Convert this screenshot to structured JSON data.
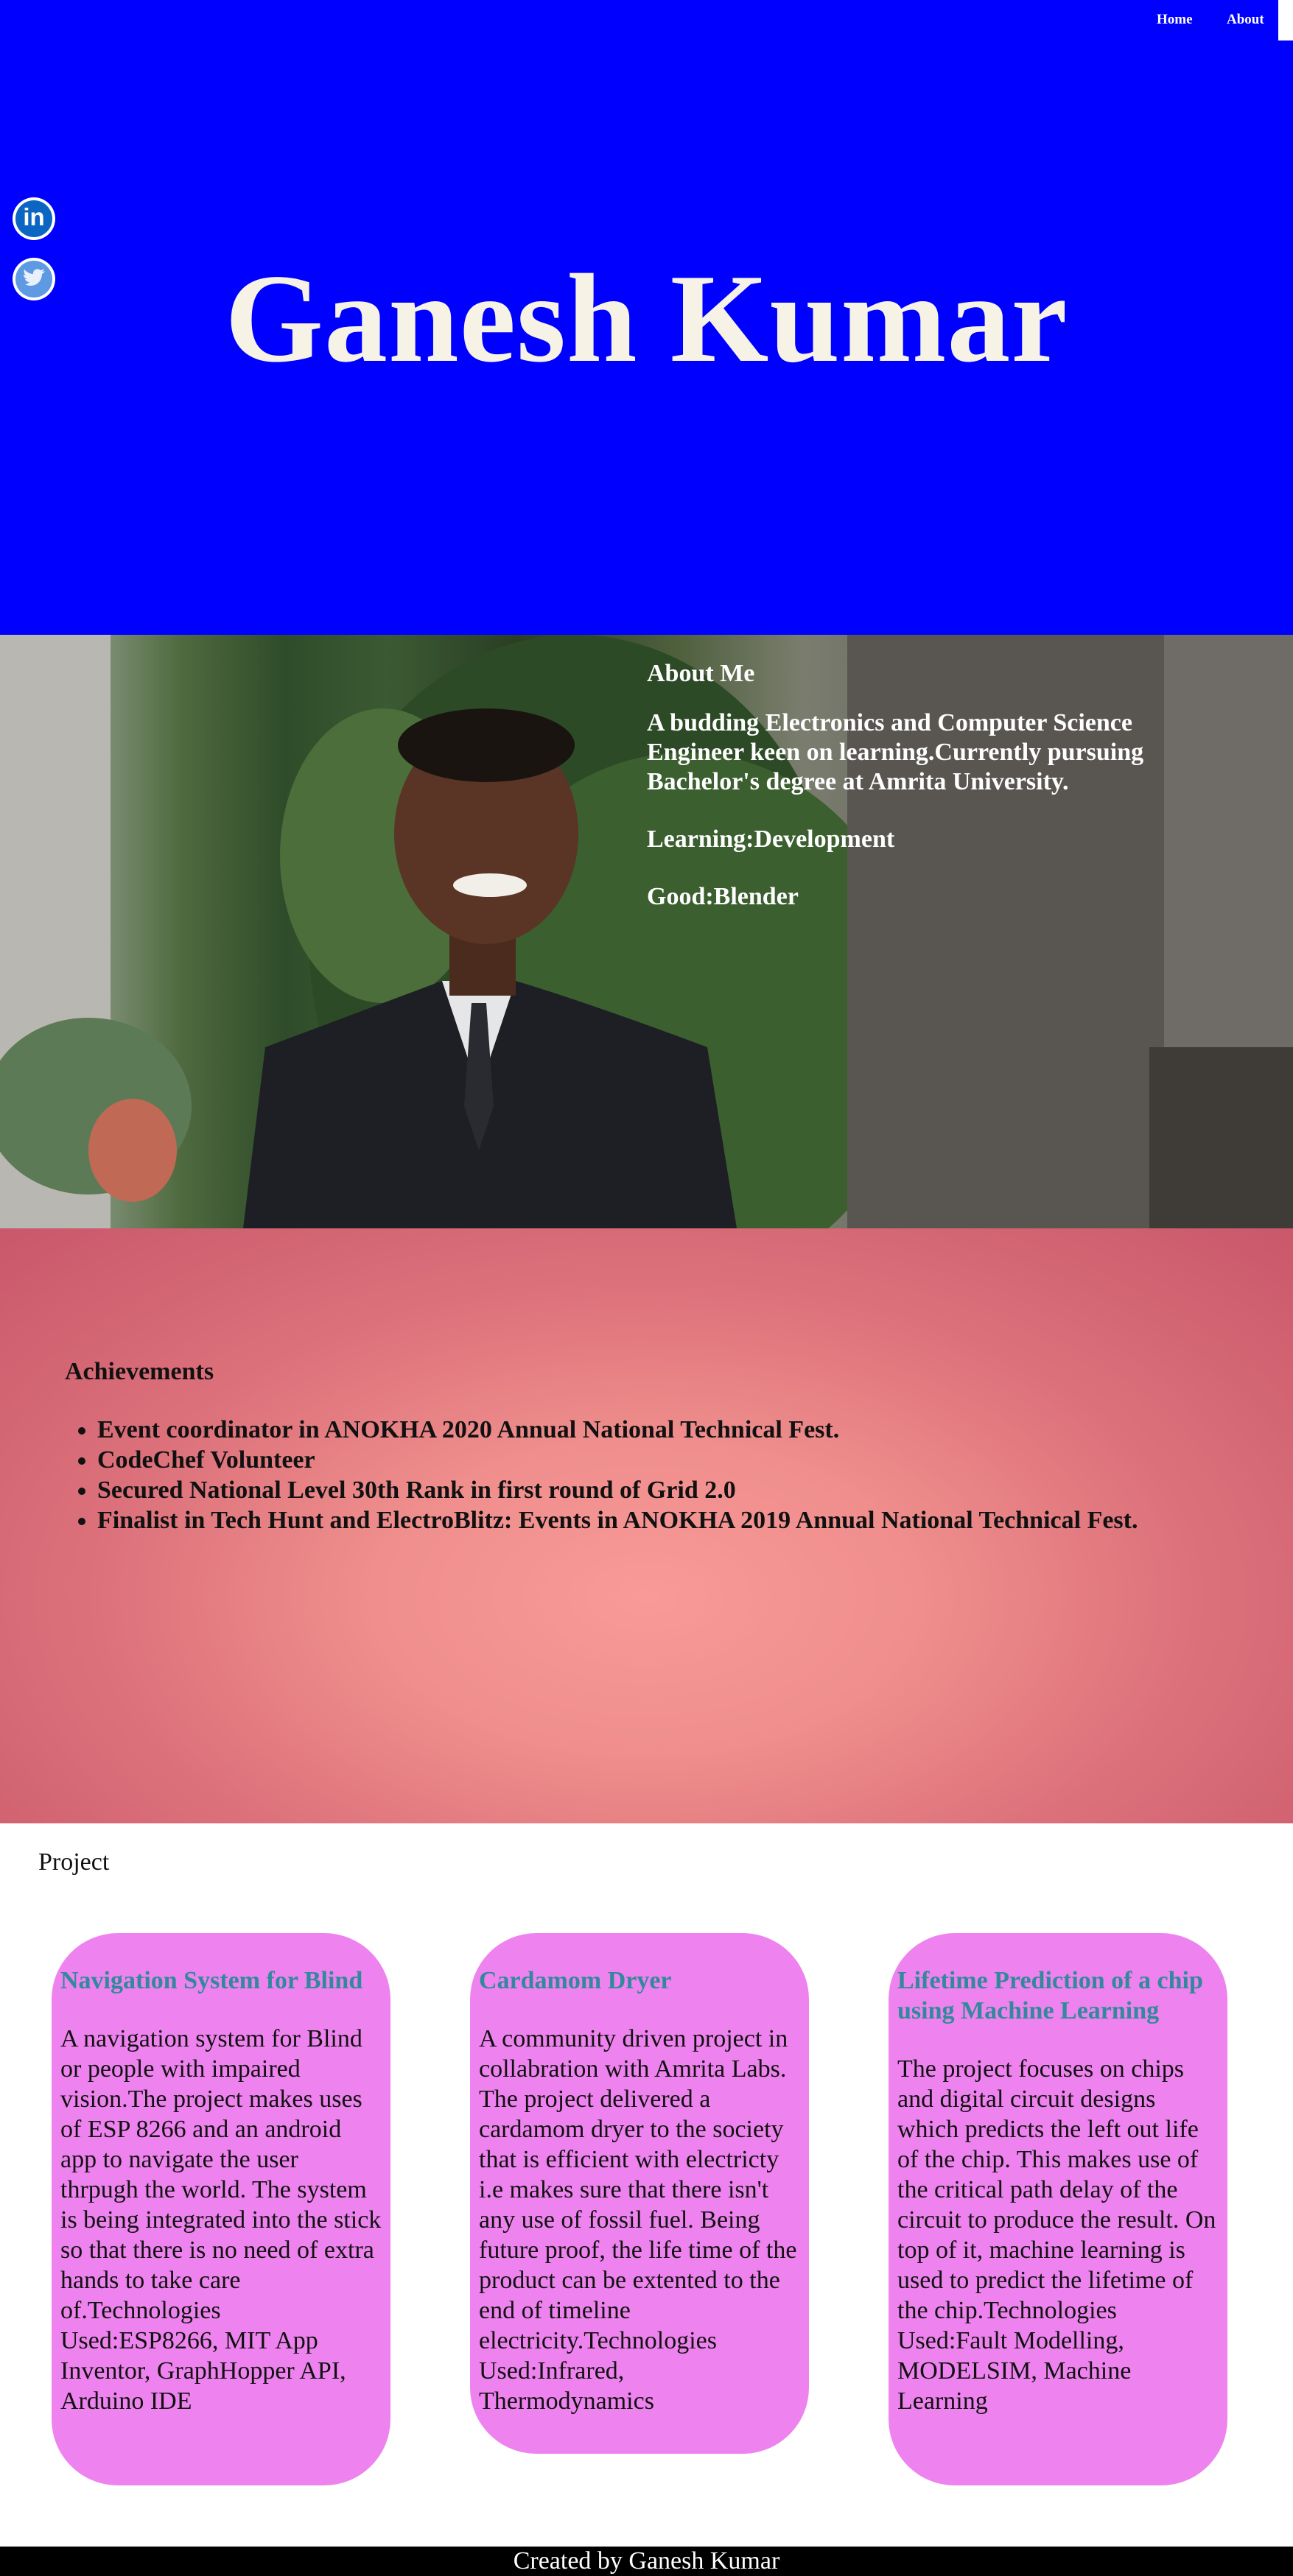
{
  "nav": {
    "home_label": "Home",
    "about_label": "About"
  },
  "hero": {
    "title": "Ganesh Kumar",
    "linkedin_glyph": "in",
    "icons": [
      "linkedin-icon",
      "twitter-icon"
    ],
    "background_color": "#0000ff"
  },
  "about": {
    "heading": "About Me",
    "intro": "A budding Electronics and Computer Science Engineer keen on learning.Currently pursuing Bachelor's degree at Amrita University.",
    "learning": "Learning:Development",
    "good": "Good:Blender"
  },
  "achievements": {
    "heading": "Achievements",
    "items": [
      "Event coordinator in ANOKHA 2020 Annual National Technical Fest.",
      "CodeChef Volunteer",
      "Secured National Level 30th Rank in first round of Grid 2.0",
      "Finalist in Tech Hunt and ElectroBlitz: Events in ANOKHA 2019 Annual National Technical Fest."
    ]
  },
  "projects": {
    "heading": "Project",
    "cards": [
      {
        "title": "Navigation System for Blind",
        "text": "A navigation system for Blind or people with impaired vision.The project makes uses of ESP 8266 and an android app to navigate the user thrpugh the world. The system is being integrated into the stick so that there is no need of extra hands to take care of.Technologies Used:ESP8266, MIT App Inventor, GraphHopper API, Arduino IDE"
      },
      {
        "title": "Cardamom Dryer",
        "text": "A community driven project in collabration with Amrita Labs. The project delivered a cardamom dryer to the society that is efficient with electricty i.e makes sure that there isn't any use of fossil fuel. Being future proof, the life time of the product can be extented to the end of timeline electricity.Technologies Used:Infrared, Thermodynamics"
      },
      {
        "title": "Lifetime Prediction of a chip using Machine Learning",
        "text": "The project focuses on chips and digital circuit designs which predicts the left out life of the chip. This makes use of the critical path delay of the circuit to produce the result. On top of it, machine learning is used to predict the lifetime of the chip.Technologies Used:Fault Modelling, MODELSIM, Machine Learning"
      }
    ],
    "card_color": "#ee82ee",
    "title_color": "#31899b"
  },
  "footer": {
    "text": "Created by Ganesh Kumar"
  }
}
